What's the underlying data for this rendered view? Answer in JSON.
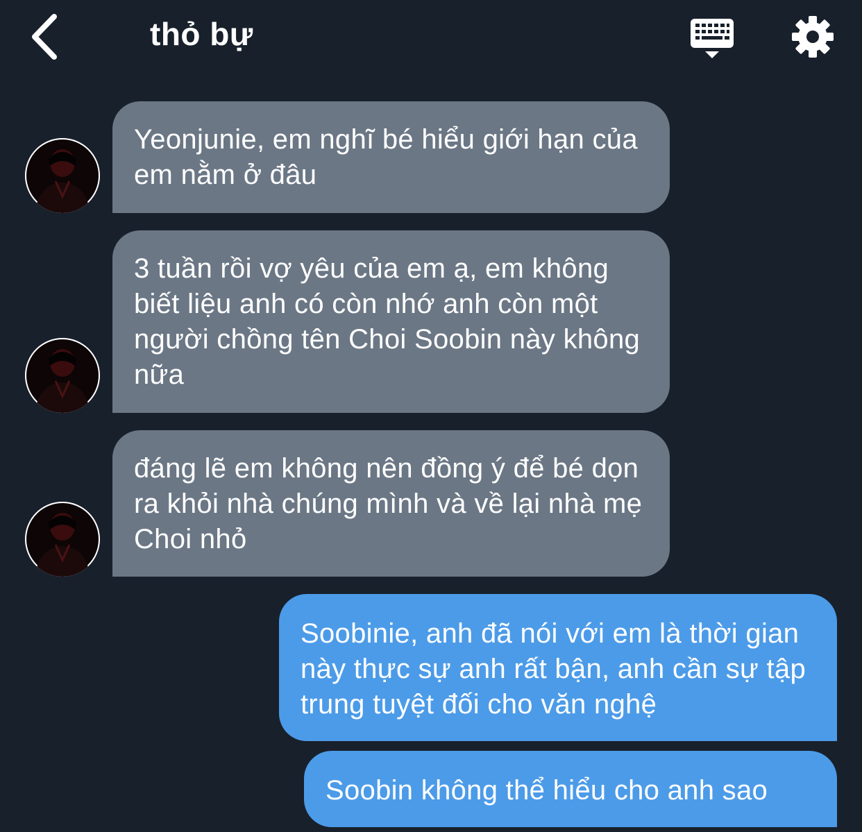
{
  "header": {
    "title": "thỏ bự",
    "back_icon": "chevron-left-icon",
    "keyboard_icon": "keyboard-icon",
    "settings_icon": "gear-icon"
  },
  "colors": {
    "background": "#18202b",
    "incoming_bubble": "#6b7785",
    "outgoing_bubble": "#4c9be8",
    "text": "#ffffff"
  },
  "messages": [
    {
      "direction": "incoming",
      "text": "Yeonjunie, em nghĩ bé hiểu giới hạn của em nằm ở đâu"
    },
    {
      "direction": "incoming",
      "text": "3 tuần rồi vợ yêu của em ạ, em không biết liệu anh có còn nhớ anh còn một người chồng tên Choi Soobin này không nữa"
    },
    {
      "direction": "incoming",
      "text": "đáng lẽ em không nên đồng ý để bé dọn ra khỏi nhà chúng mình và về lại nhà mẹ Choi nhỏ"
    },
    {
      "direction": "outgoing",
      "text": "Soobinie, anh đã nói với em là thời gian này thực sự anh rất bận, anh cần sự tập trung tuyệt đối cho văn nghệ"
    },
    {
      "direction": "outgoing",
      "text": "Soobin không thể hiểu cho anh sao"
    }
  ]
}
